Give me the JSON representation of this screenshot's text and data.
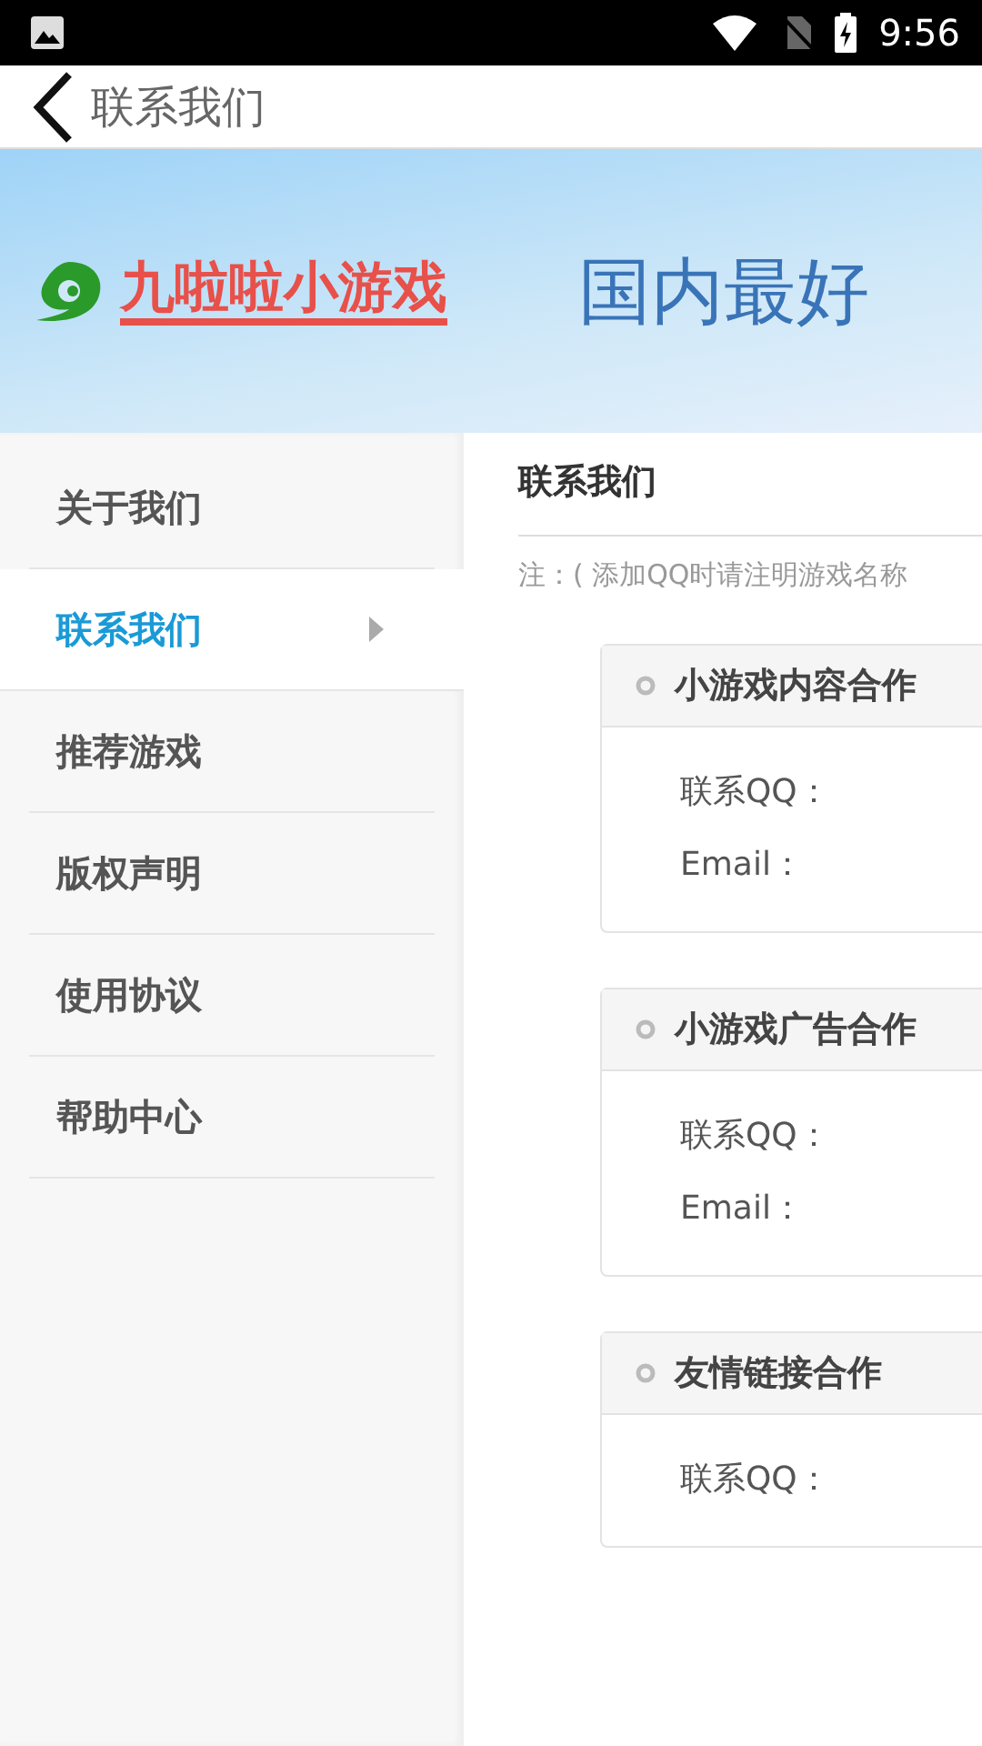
{
  "status_bar": {
    "time": "9:56"
  },
  "app_bar": {
    "title": "联系我们"
  },
  "banner": {
    "logo_text": "九啦啦小游戏",
    "slogan": "国内最好"
  },
  "sidebar": {
    "items": [
      {
        "label": "关于我们",
        "selected": false
      },
      {
        "label": "联系我们",
        "selected": true
      },
      {
        "label": "推荐游戏",
        "selected": false
      },
      {
        "label": "版权声明",
        "selected": false
      },
      {
        "label": "使用协议",
        "selected": false
      },
      {
        "label": "帮助中心",
        "selected": false
      }
    ]
  },
  "content": {
    "title": "联系我们",
    "note": "注：( 添加QQ时请注明游戏名称",
    "cards": [
      {
        "title": "小游戏内容合作",
        "fields": [
          "联系QQ：",
          "Email："
        ]
      },
      {
        "title": "小游戏广告合作",
        "fields": [
          "联系QQ：",
          "Email："
        ]
      },
      {
        "title": "友情链接合作",
        "fields": [
          "联系QQ："
        ]
      }
    ]
  }
}
